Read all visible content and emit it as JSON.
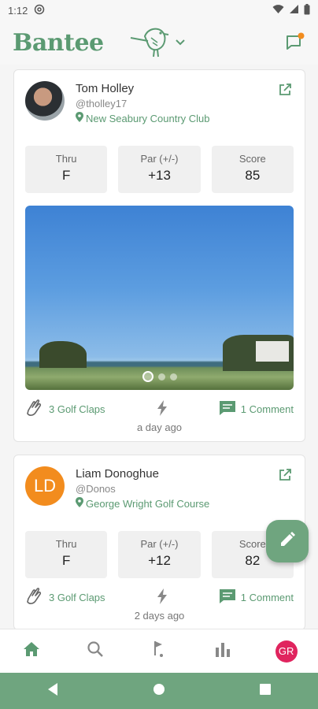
{
  "status_bar": {
    "time": "1:12"
  },
  "header": {
    "brand": "Bantee"
  },
  "feed": [
    {
      "name": "Tom Holley",
      "handle": "@tholley17",
      "course": "New Seabury Country Club",
      "stats": [
        {
          "label": "Thru",
          "value": "F"
        },
        {
          "label": "Par (+/-)",
          "value": "+13"
        },
        {
          "label": "Score",
          "value": "85"
        }
      ],
      "claps": "3 Golf Claps",
      "comments": "1 Comment",
      "time_ago": "a day ago"
    },
    {
      "name": "Liam Donoghue",
      "handle": "@Donos",
      "initials": "LD",
      "course": "George Wright Golf Course",
      "stats": [
        {
          "label": "Thru",
          "value": "F"
        },
        {
          "label": "Par (+/-)",
          "value": "+12"
        },
        {
          "label": "Score",
          "value": "82"
        }
      ],
      "claps": "3 Golf Claps",
      "comments": "1 Comment",
      "time_ago": "2 days ago"
    }
  ],
  "bottom_nav": {
    "profile_initials": "GR"
  },
  "colors": {
    "brand_green": "#5b9a72",
    "fab_green": "#6fa57f",
    "notification_orange": "#f28c1e",
    "profile_pink": "#e0245e"
  }
}
